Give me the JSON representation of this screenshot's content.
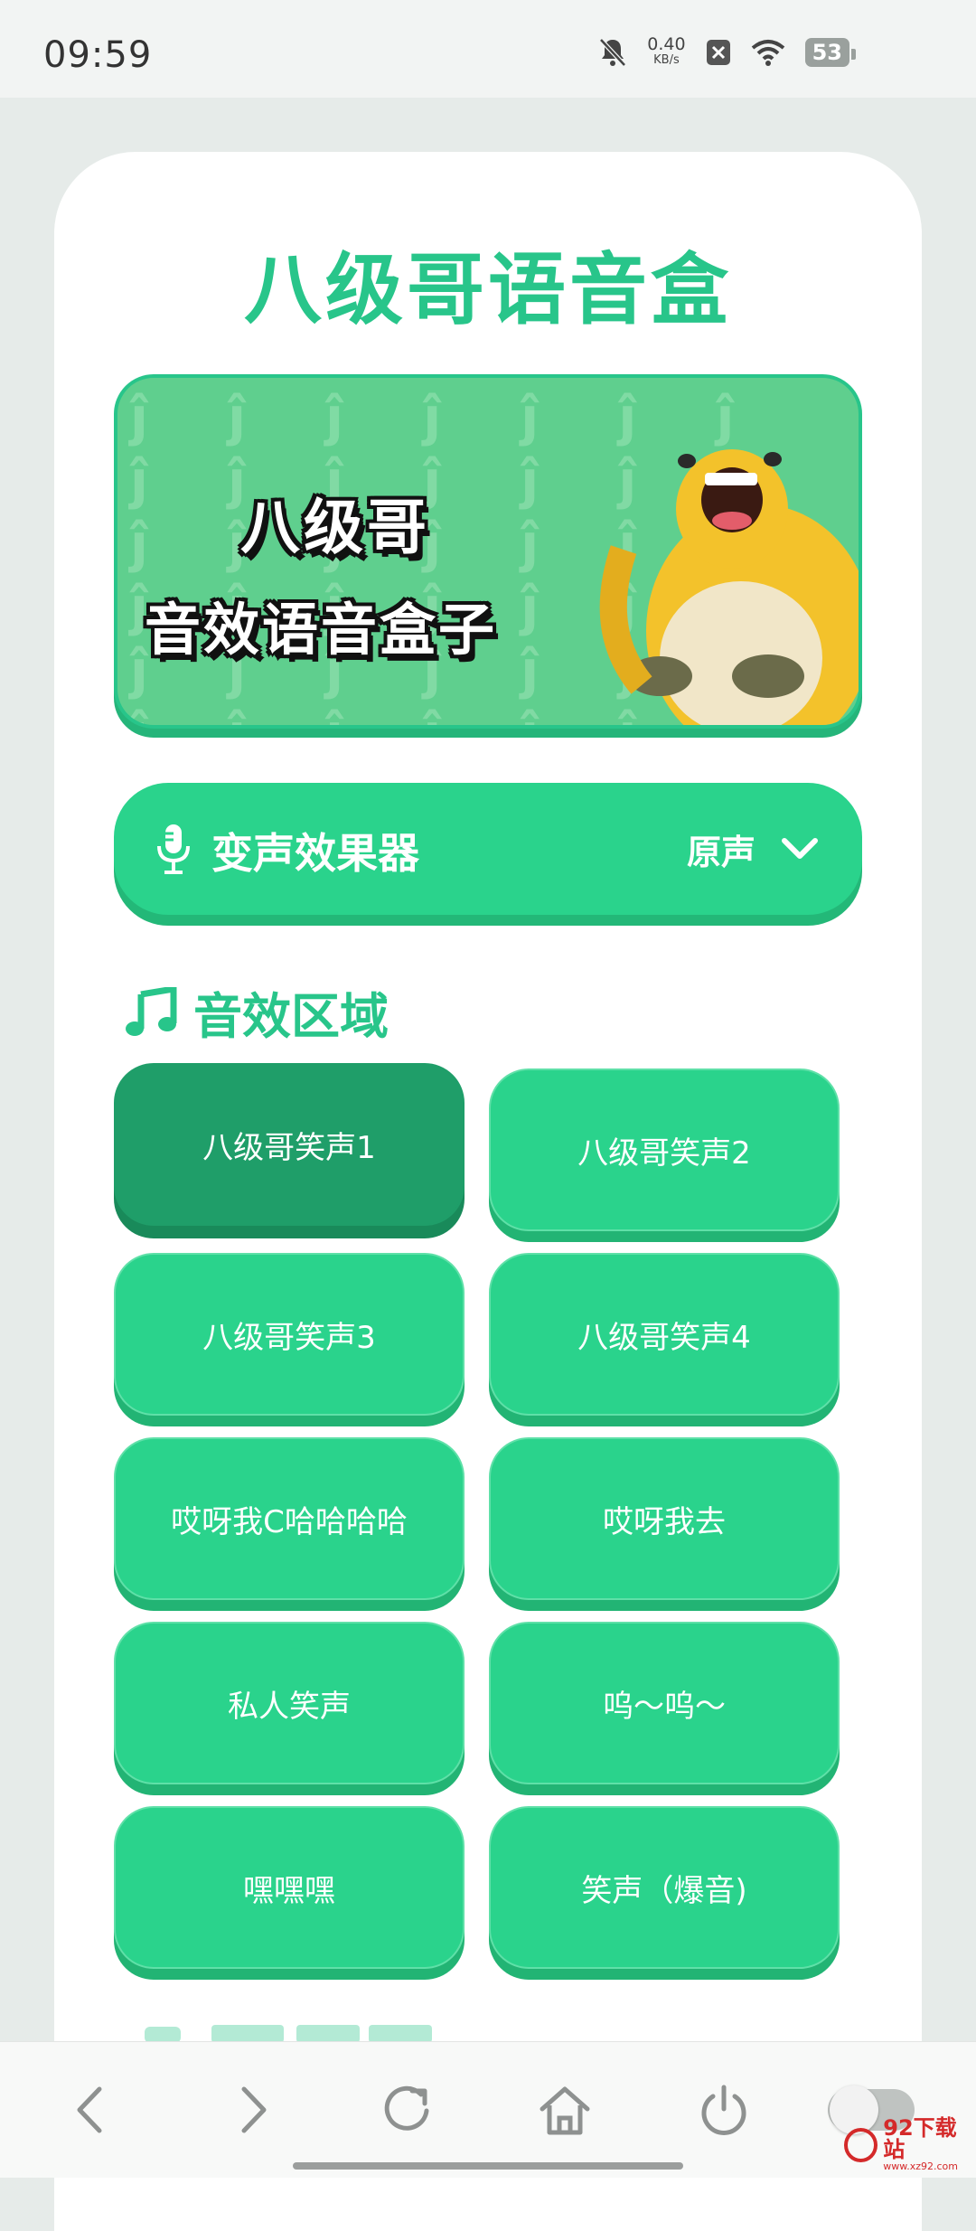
{
  "status_bar": {
    "time": "09:59",
    "net_speed_value": "0.40",
    "net_speed_unit": "KB/s",
    "battery": "53"
  },
  "app": {
    "title": "八级哥语音盒"
  },
  "banner": {
    "line1": "八级哥",
    "line2": "音效语音盒子"
  },
  "voice_changer": {
    "label": "变声效果器",
    "value": "原声"
  },
  "sound_section": {
    "title": "音效区域",
    "buttons": [
      {
        "label": "八级哥笑声1"
      },
      {
        "label": "八级哥笑声2"
      },
      {
        "label": "八级哥笑声3"
      },
      {
        "label": "八级哥笑声4"
      },
      {
        "label": "哎呀我C哈哈哈哈"
      },
      {
        "label": "哎呀我去"
      },
      {
        "label": "私人笑声"
      },
      {
        "label": "呜～呜～"
      },
      {
        "label": "嘿嘿嘿"
      },
      {
        "label": "笑声（爆音)"
      }
    ]
  },
  "watermark": {
    "name": "92下载站",
    "url": "www.xz92.com"
  },
  "colors": {
    "accent": "#28c58a",
    "button": "#2ad38c",
    "button_active": "#1f9e69"
  }
}
